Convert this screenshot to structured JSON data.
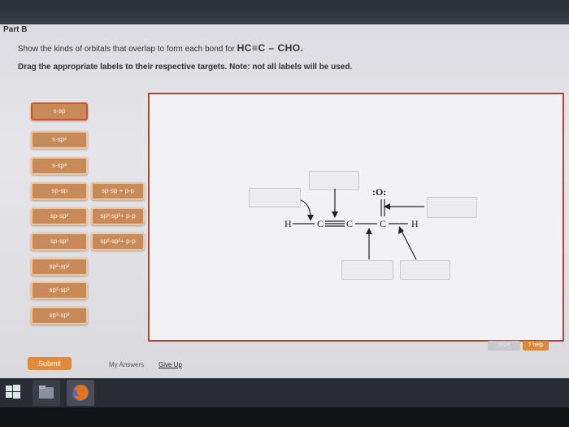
{
  "part_label": "Part B",
  "question": {
    "line1": "Show the kinds of orbitals that overlap to form each bond for",
    "formula": "HC≡C – CHO.",
    "line2_bold": "Drag the appropriate labels to their respective targets. Note: not all labels will be used."
  },
  "labels_col1": [
    "s-sp",
    "s-sp²",
    "s-sp³",
    "sp-sp",
    "sp-sp²",
    "sp-sp³",
    "sp²-sp²",
    "sp²-sp³",
    "sp³-sp³"
  ],
  "labels_col2": [
    "sp-sp + p-p",
    "sp²-sp²+ p-p",
    "sp³-sp³+ p-p"
  ],
  "molecule": {
    "atoms": [
      "H",
      "C",
      "C",
      "C",
      "H",
      ":O:"
    ]
  },
  "buttons": {
    "reset": "reset",
    "help": "? help",
    "submit": "Submit"
  },
  "links": {
    "my_answers": "My Answers",
    "give_up": "Give Up"
  },
  "colors": {
    "label_fill": "#c98a5a",
    "label_border": "#f2c59a",
    "submit": "#e08a3a",
    "target_border": "#a54a3a"
  }
}
